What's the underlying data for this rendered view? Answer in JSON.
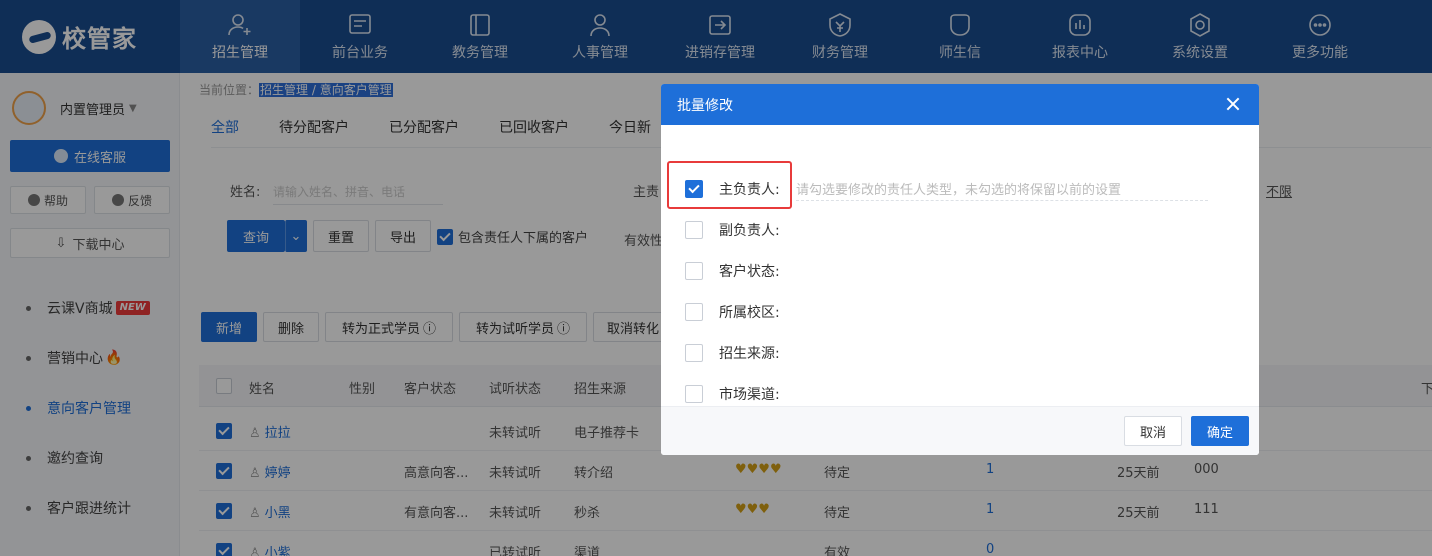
{
  "app": {
    "logo_text": "校管家"
  },
  "nav": [
    {
      "label": "招生管理",
      "icon": "user-add-icon"
    },
    {
      "label": "前台业务",
      "icon": "reception-icon"
    },
    {
      "label": "教务管理",
      "icon": "book-icon"
    },
    {
      "label": "人事管理",
      "icon": "person-icon"
    },
    {
      "label": "进销存管理",
      "icon": "inventory-icon"
    },
    {
      "label": "财务管理",
      "icon": "finance-icon"
    },
    {
      "label": "师生信",
      "icon": "message-icon"
    },
    {
      "label": "报表中心",
      "icon": "report-icon"
    },
    {
      "label": "系统设置",
      "icon": "settings-icon"
    },
    {
      "label": "更多功能",
      "icon": "more-icon"
    }
  ],
  "sidebar": {
    "user_name": "内置管理员",
    "online_service": "在线客服",
    "help": "帮助",
    "feedback": "反馈",
    "download_center": "下载中心",
    "menu": [
      {
        "label": "云课V商城",
        "badge": "NEW"
      },
      {
        "label": "营销中心",
        "flame": "🔥"
      },
      {
        "label": "意向客户管理"
      },
      {
        "label": "邀约查询"
      },
      {
        "label": "客户跟进统计"
      }
    ]
  },
  "main": {
    "breadcrumb_prefix": "当前位置：",
    "breadcrumb_path": "招生管理 / 意向客户管理",
    "tabs": [
      "全部",
      "待分配客户",
      "已分配客户",
      "已回收客户",
      "今日新"
    ],
    "filter": {
      "name_label": "姓名:",
      "name_placeholder": "请输入姓名、拼音、电话",
      "owner_label": "主责",
      "unlimited": "不限",
      "validity_label": "有效性"
    },
    "actions": {
      "query": "查询",
      "reset": "重置",
      "export": "导出",
      "include_sub": "包含责任人下属的客户"
    },
    "toolbar": {
      "add": "新增",
      "delete": "删除",
      "to_formal": "转为正式学员",
      "to_trial": "转为试听学员",
      "cancel_convert": "取消转化"
    },
    "table": {
      "headers": [
        "姓名",
        "性别",
        "客户状态",
        "试听状态",
        "招生来源"
      ],
      "right_header": "下",
      "rows": [
        {
          "name": "拉拉",
          "status": "",
          "trial": "未转试听",
          "source": "电子推荐卡",
          "hearts": "",
          "state": "",
          "count": "",
          "time": "",
          "code": ""
        },
        {
          "name": "婷婷",
          "status": "高意向客...",
          "trial": "未转试听",
          "source": "转介绍",
          "hearts": "♥♥♥♥",
          "state": "待定",
          "count": "1",
          "time": "25天前",
          "code": "000"
        },
        {
          "name": "小黑",
          "status": "有意向客...",
          "trial": "未转试听",
          "source": "秒杀",
          "hearts": "♥♥♥",
          "state": "待定",
          "count": "1",
          "time": "25天前",
          "code": "111"
        },
        {
          "name": "小紫",
          "status": "",
          "trial": "已转试听",
          "source": "渠道",
          "hearts": "",
          "state": "有效",
          "count": "0",
          "time": "",
          "code": ""
        }
      ]
    }
  },
  "modal": {
    "title": "批量修改",
    "hint": "请勾选要修改的责任人类型，未勾选的将保留以前的设置",
    "options": [
      {
        "label": "主负责人:",
        "checked": true
      },
      {
        "label": "副负责人:",
        "checked": false
      },
      {
        "label": "客户状态:",
        "checked": false
      },
      {
        "label": "所属校区:",
        "checked": false
      },
      {
        "label": "招生来源:",
        "checked": false
      },
      {
        "label": "市场渠道:",
        "checked": false
      }
    ],
    "cancel": "取消",
    "confirm": "确定"
  },
  "colors": {
    "topbar": "#1a4d8f",
    "primary": "#1e6fd9",
    "highlight_box": "#e83b3b"
  }
}
